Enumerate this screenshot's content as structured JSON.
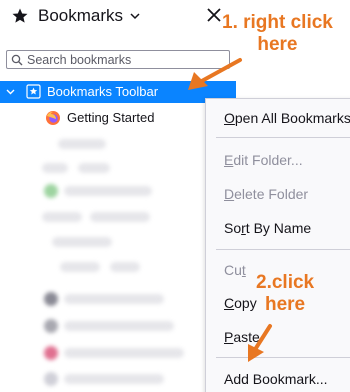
{
  "sidebar": {
    "title": "Bookmarks",
    "search": {
      "placeholder": "Search bookmarks",
      "value": ""
    },
    "tree": {
      "toolbar_folder": "Bookmarks Toolbar",
      "items": [
        {
          "label": "Getting Started",
          "icon": "firefox-icon"
        }
      ]
    }
  },
  "context_menu": {
    "items": [
      {
        "label": "Open All Bookmarks",
        "mnemonic": "O",
        "rest": "pen All Bookmarks",
        "enabled": true
      },
      {
        "label": "Edit Folder...",
        "mnemonic": "E",
        "rest": "dit Folder...",
        "enabled": false
      },
      {
        "label": "Delete Folder",
        "mnemonic": "D",
        "rest": "elete Folder",
        "enabled": false
      },
      {
        "label": "Sort By Name",
        "mnemonic": "r",
        "rest_pre": "So",
        "rest_post": "t By Name",
        "enabled": true
      },
      {
        "label": "Cut",
        "pre": "Cu",
        "mnemonic": "t",
        "enabled": false
      },
      {
        "label": "Copy",
        "mnemonic": "C",
        "rest": "opy",
        "enabled": true
      },
      {
        "label": "Paste",
        "mnemonic": "P",
        "rest": "aste",
        "enabled": true
      },
      {
        "label": "Add Bookmark...",
        "enabled": true
      }
    ]
  },
  "annotations": {
    "step1_line1": "1. right click",
    "step1_line2": "here",
    "step2_line1": "2.click",
    "step2_line2": "here",
    "color": "#e87722"
  },
  "colors": {
    "selection": "#0a84ff",
    "menu_bg": "#f9f9fb",
    "disabled_text": "#8f8f9d"
  }
}
